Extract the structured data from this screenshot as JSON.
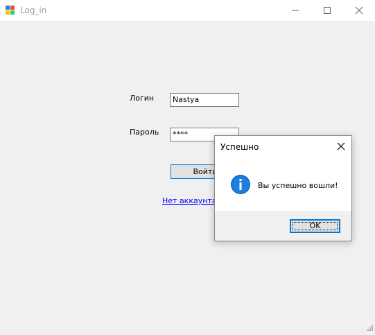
{
  "window": {
    "title": "Log_in",
    "icon": "winforms-app-icon"
  },
  "form": {
    "login_label": "Логин",
    "login_value": "Nastya",
    "password_label": "Пароль",
    "password_value": "****",
    "login_button_label": "Войти",
    "register_link_text": "Нет аккаунта, с"
  },
  "dialog": {
    "title": "Успешно",
    "message": "Вы успешно вошли!",
    "ok_label": "OK",
    "icon": "info-icon"
  },
  "colors": {
    "accent": "#0078d7",
    "link": "#0000ff",
    "background": "#f0f0f0"
  }
}
